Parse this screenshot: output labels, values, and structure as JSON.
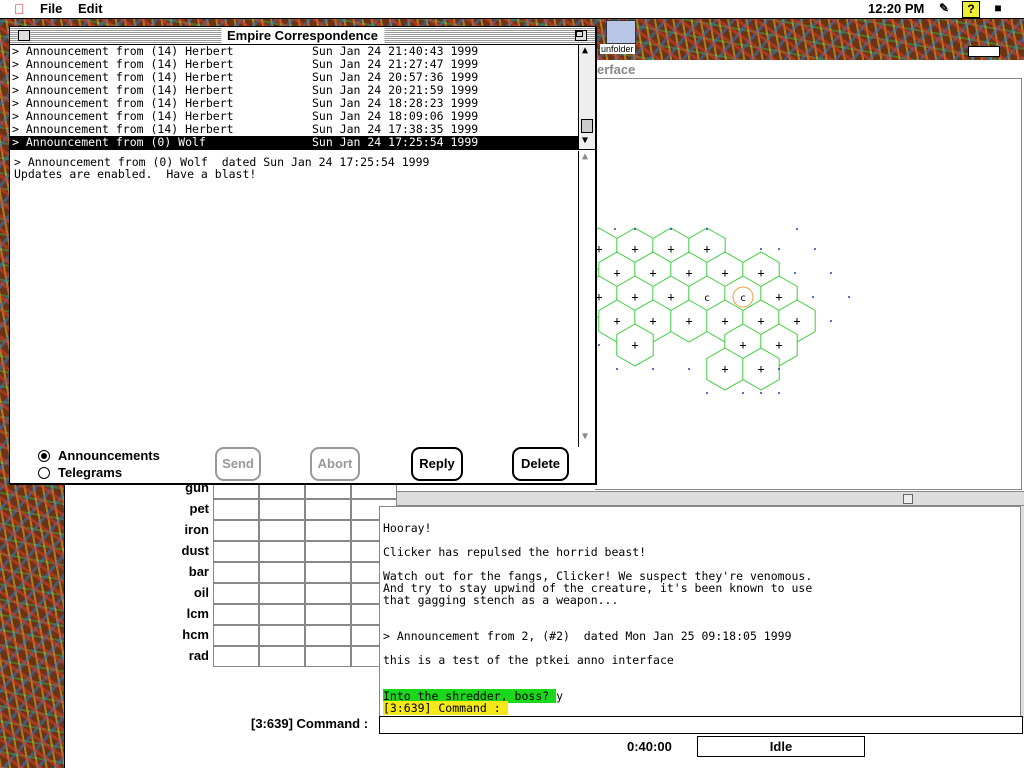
{
  "menubar": {
    "file": "File",
    "edit": "Edit",
    "clock": "12:20 PM"
  },
  "desktop": {
    "folder_name": "unfolder"
  },
  "main_window": {
    "title_fragment": "erface",
    "commodities": [
      "gun",
      "pet",
      "iron",
      "dust",
      "bar",
      "oil",
      "lcm",
      "hcm",
      "rad"
    ],
    "output_lines": [
      "Hooray!",
      "Clicker has repulsed the horrid beast!",
      "Watch out for the fangs, Clicker! We suspect they're venomous.",
      "And try to stay upwind of the creature, it's been known to use",
      "that gagging stench as a weapon...",
      "> Announcement from 2, (#2)  dated Mon Jan 25 09:18:05 1999",
      "this is a test of the ptkei anno interface",
      "Into the shredder, boss? ",
      "y",
      "[3:639] Command : "
    ],
    "command_label": "[3:639] Command :",
    "timer": "0:40:00",
    "status": "Idle",
    "map_labels": [
      "c",
      "c"
    ]
  },
  "correspondence": {
    "title": "Empire Correspondence",
    "messages": [
      {
        "from": "> Announcement from (14) Herbert",
        "date": "Sun Jan 24 21:40:43 1999",
        "selected": false
      },
      {
        "from": "> Announcement from (14) Herbert",
        "date": "Sun Jan 24 21:27:47 1999",
        "selected": false
      },
      {
        "from": "> Announcement from (14) Herbert",
        "date": "Sun Jan 24 20:57:36 1999",
        "selected": false
      },
      {
        "from": "> Announcement from (14) Herbert",
        "date": "Sun Jan 24 20:21:59 1999",
        "selected": false
      },
      {
        "from": "> Announcement from (14) Herbert",
        "date": "Sun Jan 24 18:28:23 1999",
        "selected": false
      },
      {
        "from": "> Announcement from (14) Herbert",
        "date": "Sun Jan 24 18:09:06 1999",
        "selected": false
      },
      {
        "from": "> Announcement from (14) Herbert",
        "date": "Sun Jan 24 17:38:35 1999",
        "selected": false
      },
      {
        "from": "> Announcement from (0) Wolf",
        "date": "Sun Jan 24 17:25:54 1999",
        "selected": true
      }
    ],
    "body_lines": [
      "> Announcement from (0) Wolf  dated Sun Jan 24 17:25:54 1999",
      "Updates are enabled.  Have a blast!"
    ],
    "radio_announcements": "Announcements",
    "radio_telegrams": "Telegrams",
    "selected_mode": "Announcements",
    "send": "Send",
    "abort": "Abort",
    "reply": "Reply",
    "delete": "Delete"
  }
}
